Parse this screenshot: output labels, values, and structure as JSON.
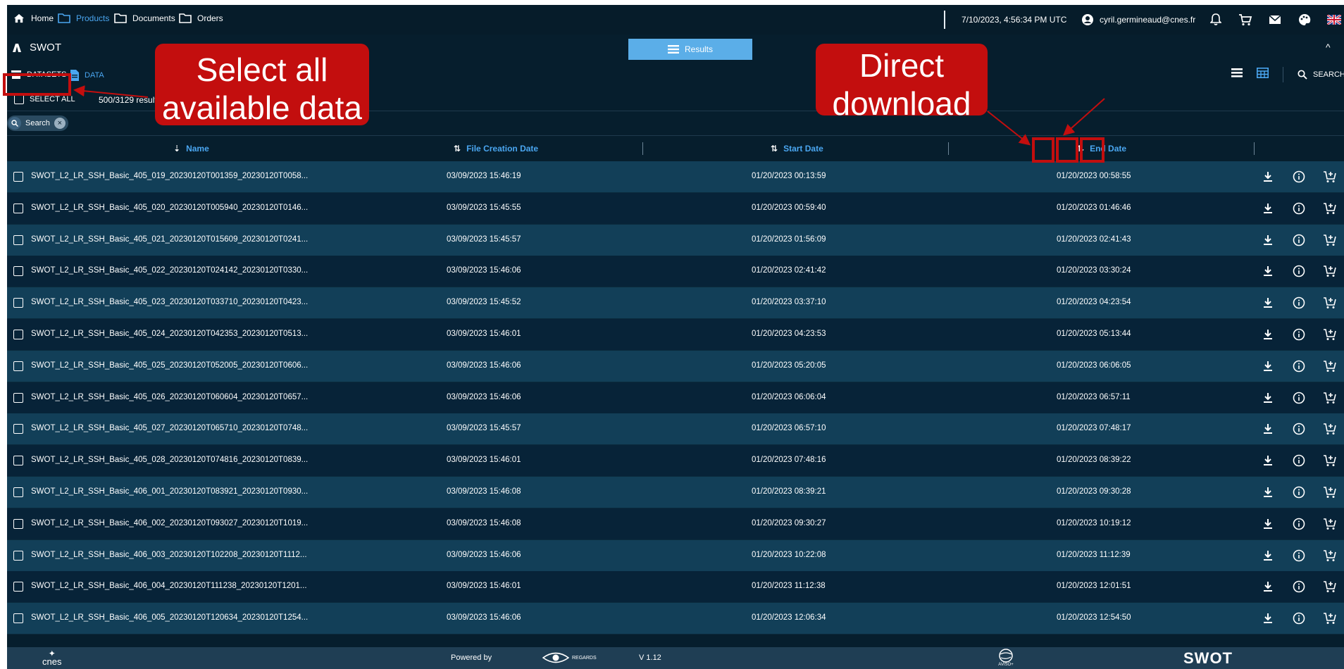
{
  "nav": {
    "home": "Home",
    "products": "Products",
    "documents": "Documents",
    "orders": "Orders",
    "datetime": "7/10/2023, 4:56:34 PM UTC",
    "user": "cyril.germineaud@cnes.fr"
  },
  "module": {
    "title": "SWOT",
    "results_tab": "Results"
  },
  "subtabs": {
    "datasets": "DATASETS",
    "data": "DATA",
    "search": "SEARCH"
  },
  "selection": {
    "select_all": "SELECT ALL",
    "count": "500/3129 results"
  },
  "filter": {
    "chip_label": "Search"
  },
  "table": {
    "headers": {
      "name": "Name",
      "file_creation_date": "File Creation Date",
      "start_date": "Start Date",
      "end_date": "End Date"
    },
    "rows": [
      {
        "name": "SWOT_L2_LR_SSH_Basic_405_019_20230120T001359_20230120T0058...",
        "created": "03/09/2023 15:46:19",
        "start": "01/20/2023 00:13:59",
        "end": "01/20/2023 00:58:55"
      },
      {
        "name": "SWOT_L2_LR_SSH_Basic_405_020_20230120T005940_20230120T0146...",
        "created": "03/09/2023 15:45:55",
        "start": "01/20/2023 00:59:40",
        "end": "01/20/2023 01:46:46"
      },
      {
        "name": "SWOT_L2_LR_SSH_Basic_405_021_20230120T015609_20230120T0241...",
        "created": "03/09/2023 15:45:57",
        "start": "01/20/2023 01:56:09",
        "end": "01/20/2023 02:41:43"
      },
      {
        "name": "SWOT_L2_LR_SSH_Basic_405_022_20230120T024142_20230120T0330...",
        "created": "03/09/2023 15:46:06",
        "start": "01/20/2023 02:41:42",
        "end": "01/20/2023 03:30:24"
      },
      {
        "name": "SWOT_L2_LR_SSH_Basic_405_023_20230120T033710_20230120T0423...",
        "created": "03/09/2023 15:45:52",
        "start": "01/20/2023 03:37:10",
        "end": "01/20/2023 04:23:54"
      },
      {
        "name": "SWOT_L2_LR_SSH_Basic_405_024_20230120T042353_20230120T0513...",
        "created": "03/09/2023 15:46:01",
        "start": "01/20/2023 04:23:53",
        "end": "01/20/2023 05:13:44"
      },
      {
        "name": "SWOT_L2_LR_SSH_Basic_405_025_20230120T052005_20230120T0606...",
        "created": "03/09/2023 15:46:06",
        "start": "01/20/2023 05:20:05",
        "end": "01/20/2023 06:06:05"
      },
      {
        "name": "SWOT_L2_LR_SSH_Basic_405_026_20230120T060604_20230120T0657...",
        "created": "03/09/2023 15:46:06",
        "start": "01/20/2023 06:06:04",
        "end": "01/20/2023 06:57:11"
      },
      {
        "name": "SWOT_L2_LR_SSH_Basic_405_027_20230120T065710_20230120T0748...",
        "created": "03/09/2023 15:45:57",
        "start": "01/20/2023 06:57:10",
        "end": "01/20/2023 07:48:17"
      },
      {
        "name": "SWOT_L2_LR_SSH_Basic_405_028_20230120T074816_20230120T0839...",
        "created": "03/09/2023 15:46:01",
        "start": "01/20/2023 07:48:16",
        "end": "01/20/2023 08:39:22"
      },
      {
        "name": "SWOT_L2_LR_SSH_Basic_406_001_20230120T083921_20230120T0930...",
        "created": "03/09/2023 15:46:08",
        "start": "01/20/2023 08:39:21",
        "end": "01/20/2023 09:30:28"
      },
      {
        "name": "SWOT_L2_LR_SSH_Basic_406_002_20230120T093027_20230120T1019...",
        "created": "03/09/2023 15:46:08",
        "start": "01/20/2023 09:30:27",
        "end": "01/20/2023 10:19:12"
      },
      {
        "name": "SWOT_L2_LR_SSH_Basic_406_003_20230120T102208_20230120T1112...",
        "created": "03/09/2023 15:46:06",
        "start": "01/20/2023 10:22:08",
        "end": "01/20/2023 11:12:39"
      },
      {
        "name": "SWOT_L2_LR_SSH_Basic_406_004_20230120T111238_20230120T1201...",
        "created": "03/09/2023 15:46:01",
        "start": "01/20/2023 11:12:38",
        "end": "01/20/2023 12:01:51"
      },
      {
        "name": "SWOT_L2_LR_SSH_Basic_406_005_20230120T120634_20230120T1254...",
        "created": "03/09/2023 15:46:06",
        "start": "01/20/2023 12:06:34",
        "end": "01/20/2023 12:54:50"
      }
    ]
  },
  "footer": {
    "cnes": "cnes",
    "powered_by": "Powered by",
    "regards": "REGARDS",
    "version": "V 1.12",
    "aviso": "AVISO+",
    "swot": "SWOT"
  },
  "annotations": {
    "select_all_callout": "Select all\navailable data",
    "download_callout": "Direct\ndownload"
  },
  "colors": {
    "background": "#061e2d",
    "row_alt": "#123f58",
    "accent": "#4aa6f0",
    "annotation": "#c30e0e"
  }
}
